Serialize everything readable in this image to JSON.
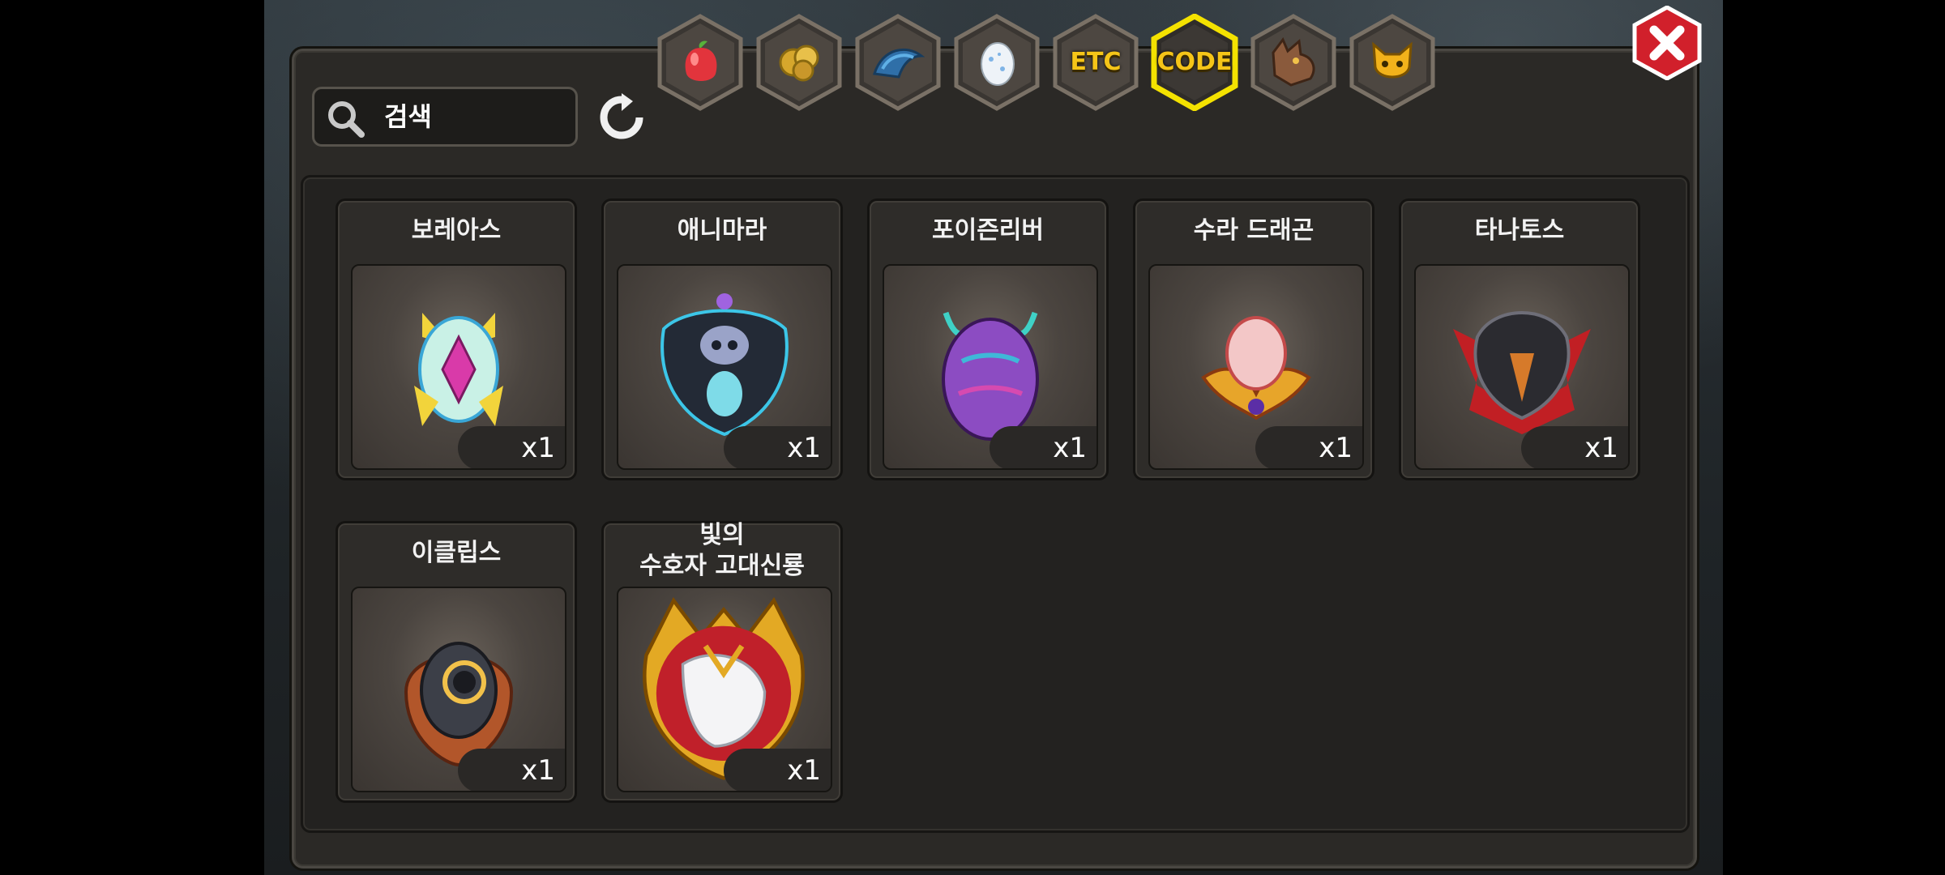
{
  "search": {
    "placeholder": "검색",
    "icon": "search-icon"
  },
  "tabs": [
    {
      "name": "fruit",
      "icon": "fruit-icon",
      "label": ""
    },
    {
      "name": "gold",
      "icon": "gold-icon",
      "label": ""
    },
    {
      "name": "scale",
      "icon": "scale-icon",
      "label": ""
    },
    {
      "name": "egg",
      "icon": "egg-icon",
      "label": ""
    },
    {
      "name": "etc",
      "icon": "",
      "label": "ETC"
    },
    {
      "name": "code",
      "icon": "",
      "label": "CODE",
      "selected": true
    },
    {
      "name": "dragon",
      "icon": "dragon-head-icon",
      "label": ""
    },
    {
      "name": "pet",
      "icon": "pet-face-icon",
      "label": ""
    }
  ],
  "items": [
    {
      "name": "보레아스",
      "qty": "x1",
      "icon": "boreas-egg-icon"
    },
    {
      "name": "애니마라",
      "qty": "x1",
      "icon": "animara-egg-icon"
    },
    {
      "name": "포이즌리버",
      "qty": "x1",
      "icon": "poison-river-egg-icon"
    },
    {
      "name": "수라 드래곤",
      "qty": "x1",
      "icon": "sura-dragon-egg-icon"
    },
    {
      "name": "타나토스",
      "qty": "x1",
      "icon": "thanatos-egg-icon"
    },
    {
      "name": "이클립스",
      "qty": "x1",
      "icon": "eclipse-egg-icon"
    },
    {
      "name_line1": "빛의",
      "name_line2": "수호자 고대신룡",
      "qty": "x1",
      "icon": "light-guardian-dragon-icon"
    }
  ],
  "colors": {
    "tab_label": "#f5c518",
    "selected_border": "#f4e200",
    "close_button": "#d1202b"
  }
}
